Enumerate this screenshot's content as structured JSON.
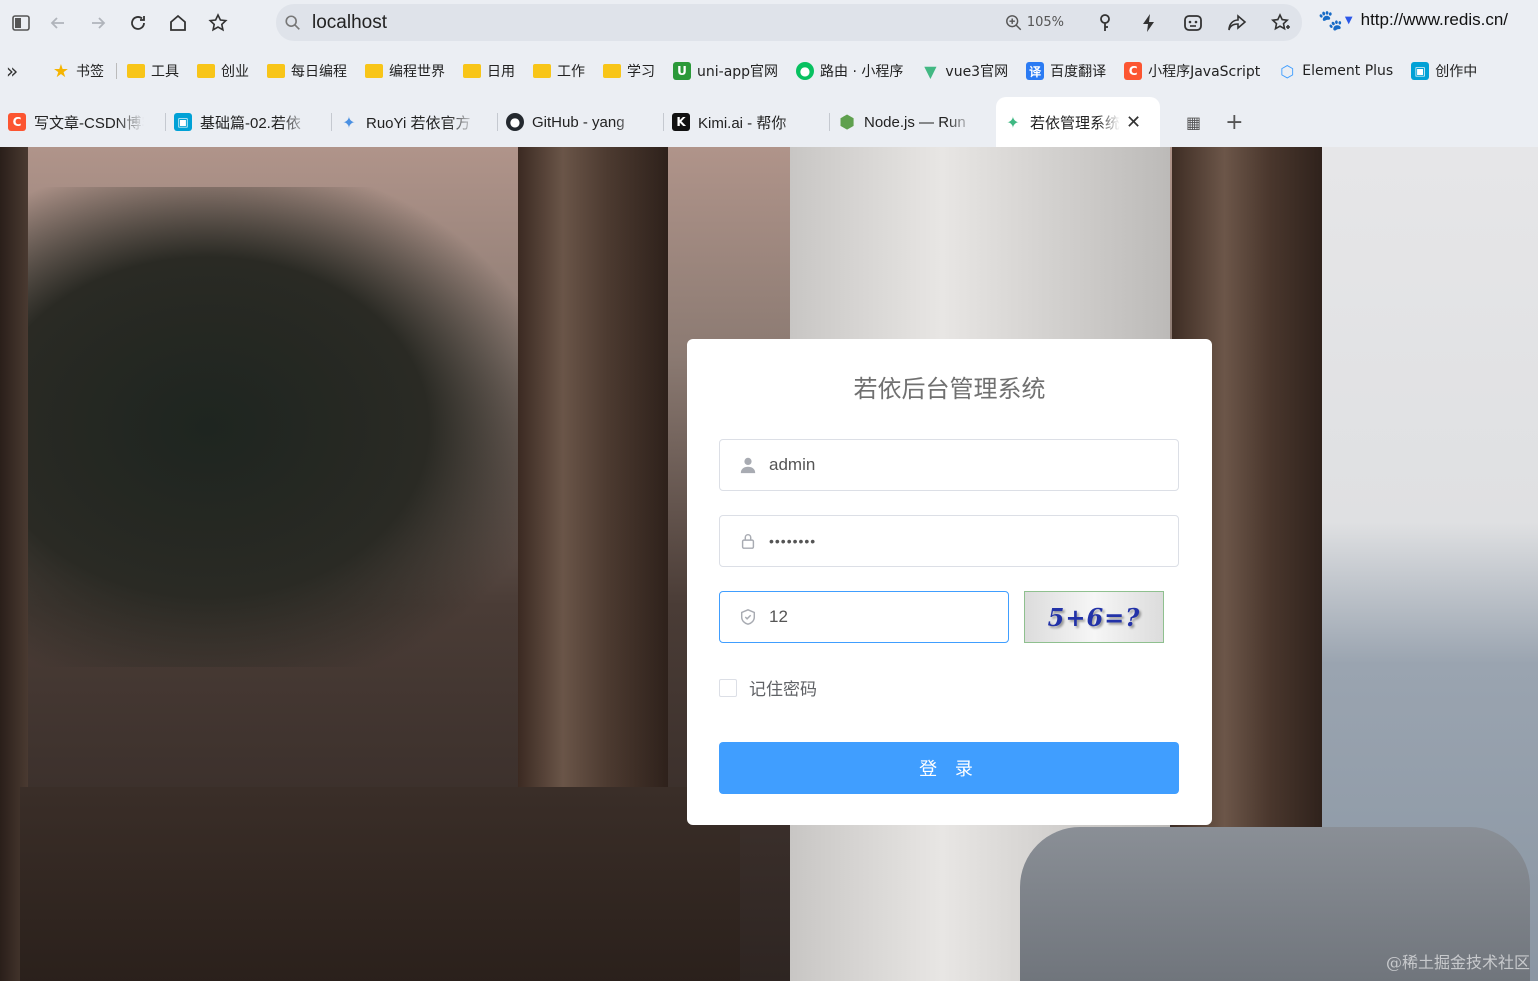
{
  "browser": {
    "address": "localhost",
    "zoom": "105%",
    "side_url": "http://www.redis.cn/"
  },
  "bookmarks": [
    {
      "label": "书签",
      "icon": "star-icon",
      "color": "#f5b400"
    },
    {
      "label": "工具",
      "icon": "folder-icon",
      "color": "#f8c518"
    },
    {
      "label": "创业",
      "icon": "folder-icon",
      "color": "#f8c518"
    },
    {
      "label": "每日编程",
      "icon": "folder-icon",
      "color": "#f8c518"
    },
    {
      "label": "编程世界",
      "icon": "folder-icon",
      "color": "#f8c518"
    },
    {
      "label": "日用",
      "icon": "folder-icon",
      "color": "#f8c518"
    },
    {
      "label": "工作",
      "icon": "folder-icon",
      "color": "#f8c518"
    },
    {
      "label": "学习",
      "icon": "folder-icon",
      "color": "#f8c518"
    },
    {
      "label": "uni-app官网",
      "icon": "uniapp-icon",
      "color": "#2b9939"
    },
    {
      "label": "路由 · 小程序",
      "icon": "wechat-icon",
      "color": "#07c160"
    },
    {
      "label": "vue3官网",
      "icon": "vue-icon",
      "color": "#42b883"
    },
    {
      "label": "百度翻译",
      "icon": "translate-icon",
      "color": "#2b7bf3"
    },
    {
      "label": "小程序JavaScript",
      "icon": "csdn-icon",
      "color": "#fc5531"
    },
    {
      "label": "Element Plus",
      "icon": "element-icon",
      "color": "#409eff"
    },
    {
      "label": "创作中",
      "icon": "bilibili-icon",
      "color": "#00a1d6"
    }
  ],
  "tabs": [
    {
      "label": "写文章-CSDN博客",
      "icon": "csdn-icon",
      "color": "#fc5531",
      "glyph": "C"
    },
    {
      "label": "基础篇-02.若依",
      "icon": "bilibili-icon",
      "color": "#00a1d6",
      "glyph": "▣"
    },
    {
      "label": "RuoYi 若依官方",
      "icon": "ruoyi-icon",
      "color": "#4a90e2",
      "glyph": "✦"
    },
    {
      "label": "GitHub - yang",
      "icon": "github-icon",
      "color": "#24292f",
      "glyph": "●"
    },
    {
      "label": "Kimi.ai - 帮你",
      "icon": "kimi-icon",
      "color": "#111111",
      "glyph": "K"
    },
    {
      "label": "Node.js — Run",
      "icon": "nodejs-icon",
      "color": "#5fa04e",
      "glyph": "⬢"
    },
    {
      "label": "若依管理系统",
      "icon": "ruoyi-icon",
      "color": "#3fb883",
      "glyph": "✦",
      "active": true
    }
  ],
  "login": {
    "title": "若依后台管理系统",
    "username": "admin",
    "password_mask": "••••••••",
    "code": "12",
    "captcha_text": "5+6=?",
    "remember_label": "记住密码",
    "button_label": "登 录",
    "accent": "#409eff"
  },
  "watermark": "@稀土掘金技术社区"
}
